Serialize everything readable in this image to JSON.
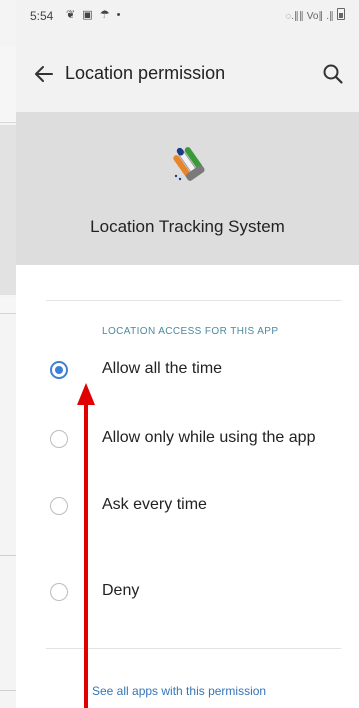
{
  "status_bar": {
    "time": "5:54",
    "left_icons": "❦ ▣ ☂ •",
    "right_icons": "◌.∥∥ Vo∥ .∥"
  },
  "app_bar": {
    "title": "Location permission",
    "back_icon": "arrow-left-icon",
    "search_icon": "search-icon"
  },
  "app_header": {
    "app_name": "Location Tracking System",
    "app_icon": "election-ink-finger-icon"
  },
  "section": {
    "header": "LOCATION ACCESS FOR THIS APP"
  },
  "options": [
    {
      "label": "Allow all the time",
      "selected": true
    },
    {
      "label": "Allow only while using the app",
      "selected": false
    },
    {
      "label": "Ask every time",
      "selected": false
    },
    {
      "label": "Deny",
      "selected": false
    }
  ],
  "footer_link": "See all apps with this permission",
  "colors": {
    "accent": "#3f7fd4",
    "section_header": "#4a8a9e",
    "annotation_arrow": "#e00000",
    "link": "#3576b8"
  }
}
